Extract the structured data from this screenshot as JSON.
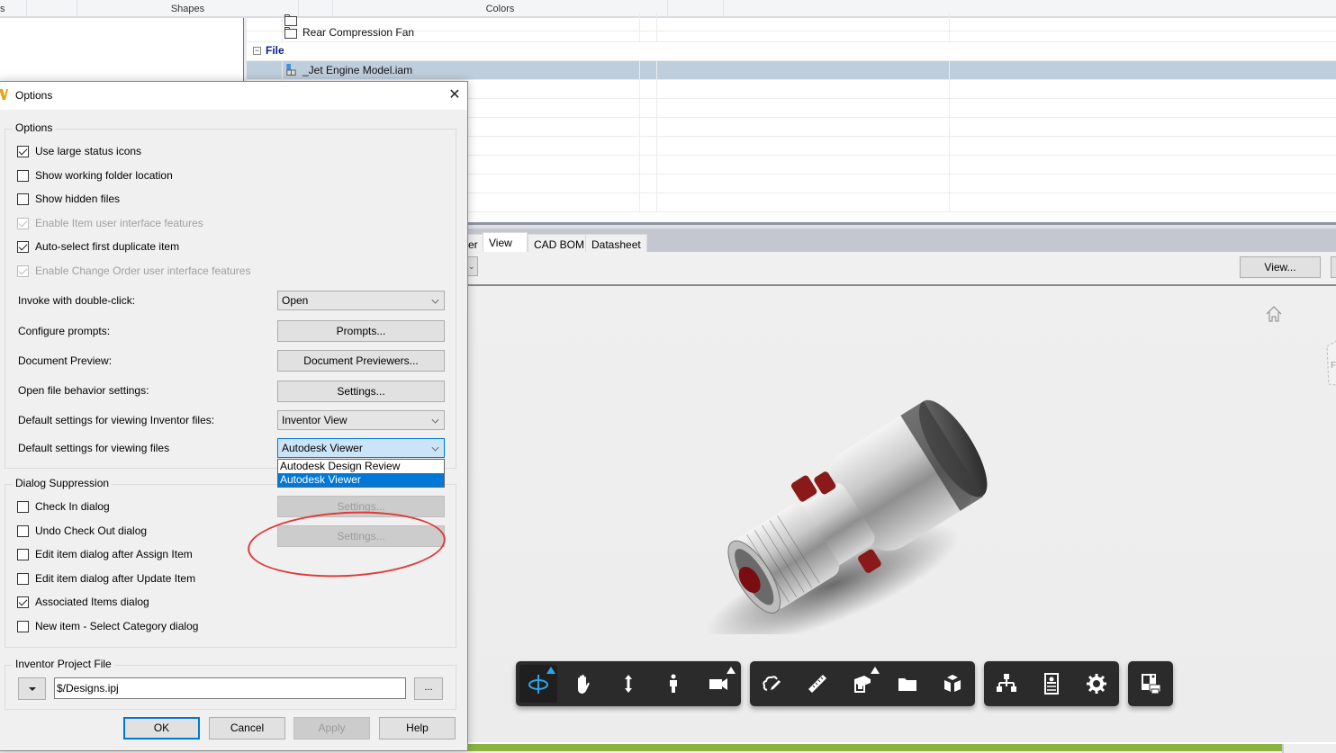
{
  "ribbon": {
    "groups": [
      "s",
      "Shapes",
      "Colors"
    ]
  },
  "grid": {
    "rows": [
      {
        "type": "item",
        "name": "",
        "icon": "folder-icon"
      },
      {
        "type": "item",
        "name": "Rear Compression Fan",
        "icon": "folder-icon"
      },
      {
        "type": "group",
        "label": "File",
        "expander": "⊟"
      },
      {
        "type": "item",
        "name": "_Jet Engine Model.iam",
        "icon": "assembly-file-icon",
        "selected": true
      }
    ]
  },
  "tabs": [
    {
      "label": "er",
      "active": false
    },
    {
      "label": "View",
      "active": true
    },
    {
      "label": "CAD BOM",
      "active": false
    },
    {
      "label": "Datasheet",
      "active": false
    }
  ],
  "viewer_toolbar": {
    "view_button": "View..."
  },
  "viewer": {
    "viewcube_face": "Fr",
    "model_name": "_Jet Engine Model.iam",
    "tool_groups": [
      [
        {
          "name": "orbit",
          "active": true,
          "has_submenu": true
        },
        {
          "name": "pan",
          "active": false,
          "has_submenu": false
        },
        {
          "name": "zoom",
          "active": false,
          "has_submenu": false
        },
        {
          "name": "first-person",
          "active": false,
          "has_submenu": false
        },
        {
          "name": "camera",
          "active": false,
          "has_submenu": true
        }
      ],
      [
        {
          "name": "markup",
          "active": false,
          "has_submenu": false
        },
        {
          "name": "measure",
          "active": false,
          "has_submenu": false
        },
        {
          "name": "section",
          "active": false,
          "has_submenu": true
        },
        {
          "name": "explode",
          "active": false,
          "has_submenu": false
        },
        {
          "name": "model-browser",
          "active": false,
          "has_submenu": false
        }
      ],
      [
        {
          "name": "structure",
          "active": false,
          "has_submenu": false
        },
        {
          "name": "properties",
          "active": false,
          "has_submenu": false
        },
        {
          "name": "settings",
          "active": false,
          "has_submenu": false
        }
      ],
      [
        {
          "name": "print",
          "active": false,
          "has_submenu": false
        }
      ]
    ],
    "accent_color": "#2ba6e8"
  },
  "dialog": {
    "title": "Options",
    "options_group": {
      "legend": "Options",
      "checkboxes": [
        {
          "label": "Use large status icons",
          "checked": true,
          "disabled": false
        },
        {
          "label": "Show working folder location",
          "checked": false,
          "disabled": false
        },
        {
          "label": "Show hidden files",
          "checked": false,
          "disabled": false
        },
        {
          "label": "Enable Item user interface features",
          "checked": true,
          "disabled": true
        },
        {
          "label": "Auto-select first duplicate item",
          "checked": true,
          "disabled": false
        },
        {
          "label": "Enable Change Order user interface features",
          "checked": true,
          "disabled": true
        }
      ],
      "settings": [
        {
          "label": "Invoke with double-click:",
          "control": "combo",
          "value": "Open"
        },
        {
          "label": "Configure prompts:",
          "control": "button",
          "value": "Prompts..."
        },
        {
          "label": "Document Preview:",
          "control": "button",
          "value": "Document Previewers..."
        },
        {
          "label": "Open file behavior settings:",
          "control": "button",
          "value": "Settings..."
        },
        {
          "label": "Default settings for viewing Inventor files:",
          "control": "combo",
          "value": "Inventor View"
        },
        {
          "label": "Default settings for viewing files",
          "control": "combo",
          "value": "Autodesk Viewer"
        }
      ],
      "viewer_dropdown_options": [
        {
          "label": "Autodesk Design Review",
          "selected": false
        },
        {
          "label": "Autodesk Viewer",
          "selected": true
        }
      ]
    },
    "suppression_group": {
      "legend": "Dialog Suppression",
      "checkboxes": [
        {
          "label": "Check In dialog",
          "checked": false
        },
        {
          "label": "Undo Check Out dialog",
          "checked": false
        },
        {
          "label": "Edit item dialog after Assign Item",
          "checked": false
        },
        {
          "label": "Edit item dialog after Update Item",
          "checked": false
        },
        {
          "label": "Associated Items dialog",
          "checked": true
        },
        {
          "label": "New item - Select Category dialog",
          "checked": false
        }
      ],
      "settings_buttons": [
        "Settings...",
        "Settings..."
      ]
    },
    "project_group": {
      "legend": "Inventor Project File",
      "value": "$/Designs.ipj",
      "browse_label": "..."
    },
    "buttons": {
      "ok": "OK",
      "cancel": "Cancel",
      "apply": "Apply",
      "help": "Help"
    },
    "annotation_color": "#e03a3a"
  }
}
